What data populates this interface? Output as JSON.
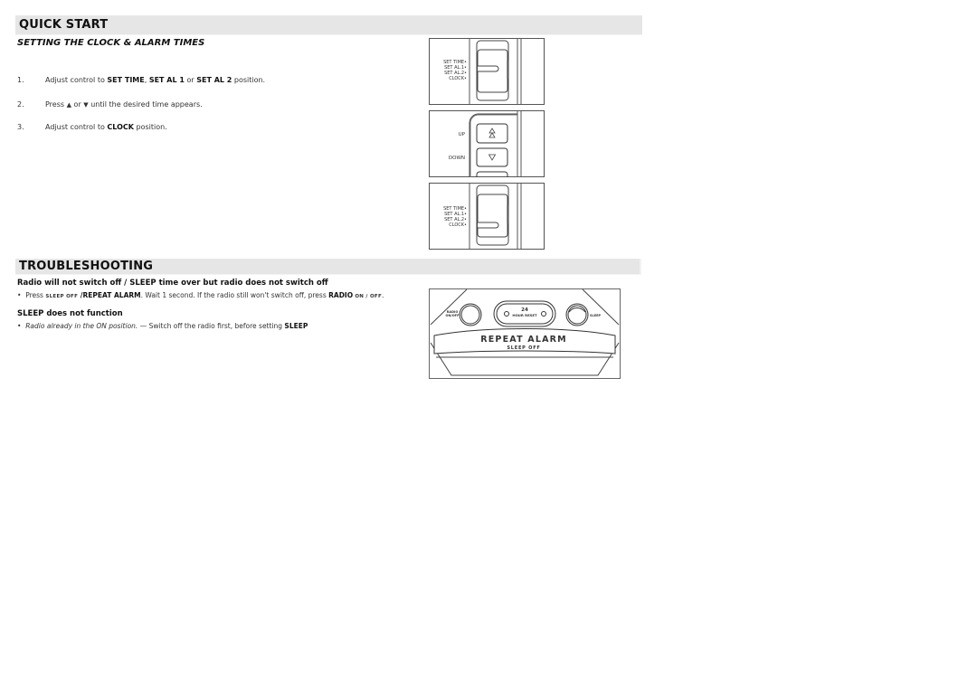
{
  "quick_start": {
    "title": "QUICK START",
    "subtitle": "SETTING THE CLOCK & ALARM  TIMES",
    "steps": [
      {
        "num": "1.",
        "pre": "Adjust control to ",
        "b1": "SET TIME",
        "mid1": ", ",
        "b2": "SET AL 1",
        "mid2": " or ",
        "b3": "SET AL 2",
        "post": " position."
      },
      {
        "num": "2.",
        "pre": "Press ",
        "up_icon": "▲",
        "mid": " or ",
        "down_icon": "▼",
        "post": " until the desired time appears."
      },
      {
        "num": "3.",
        "pre": "Adjust control to ",
        "b1": "CLOCK",
        "post": " position."
      }
    ]
  },
  "figures": {
    "switch_labels": [
      "SET TIME•",
      "SET AL.1•",
      "SET AL.2•",
      "CLOCK•"
    ],
    "up_label": "UP",
    "down_label": "DOWN",
    "up_glyph": "⇯",
    "down_glyph": "▽",
    "radio_panel": {
      "radio_label_1": "RADIO",
      "radio_label_2": "ON/OFF",
      "reset_label_1": "24",
      "reset_label_2": "HOUR RESET",
      "sleep_label": "SLEEP",
      "repeat_alarm": "REPEAT ALARM",
      "sleep_off": "SLEEP OFF"
    }
  },
  "troubleshooting": {
    "title": "TROUBLESHOOTING",
    "issues": [
      {
        "heading": "Radio will not switch off / SLEEP time over but radio does not switch off",
        "bullet": "•",
        "pre": "Press ",
        "sc1": "SLEEP OFF",
        "b1": " /REPEAT ALARM",
        "mid": ". Wait 1 second. If the radio still won't switch off, press ",
        "b2": "RADIO",
        "sc2": " ON / OFF",
        "post": "."
      },
      {
        "heading": "SLEEP does not function",
        "bullet": "•",
        "italic": "Radio already in the ON position.",
        "mid": " — Switch off the radio first, before setting ",
        "b1": "SLEEP"
      }
    ]
  }
}
